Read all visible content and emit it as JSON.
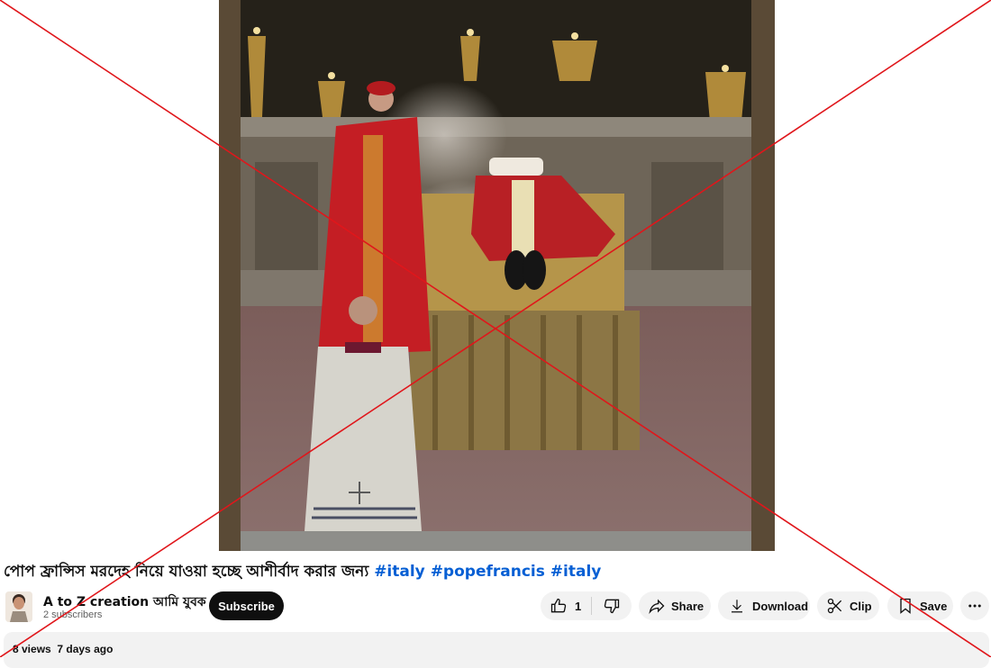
{
  "video": {
    "title_text": "পোপ ফ্রান্সিস মরদেহ নিয়ে যাওয়া হচ্ছে আশীর্বাদ করার জন্য",
    "hashtags": [
      "#italy",
      "#popefrancis",
      "#italy"
    ]
  },
  "channel": {
    "name": "A to Z creation আমি যুবক",
    "subscribers": "2 subscribers",
    "subscribe_label": "Subscribe"
  },
  "actions": {
    "like_count": "1",
    "share_label": "Share",
    "download_label": "Download",
    "clip_label": "Clip",
    "save_label": "Save"
  },
  "description": {
    "views": "8 views",
    "age": "7 days ago"
  },
  "overlay": {
    "color": "#e0161b"
  },
  "colors": {
    "hashtag": "#065fd4",
    "subscribe_bg": "#0f0f0f",
    "pill_bg": "#f2f2f2"
  }
}
